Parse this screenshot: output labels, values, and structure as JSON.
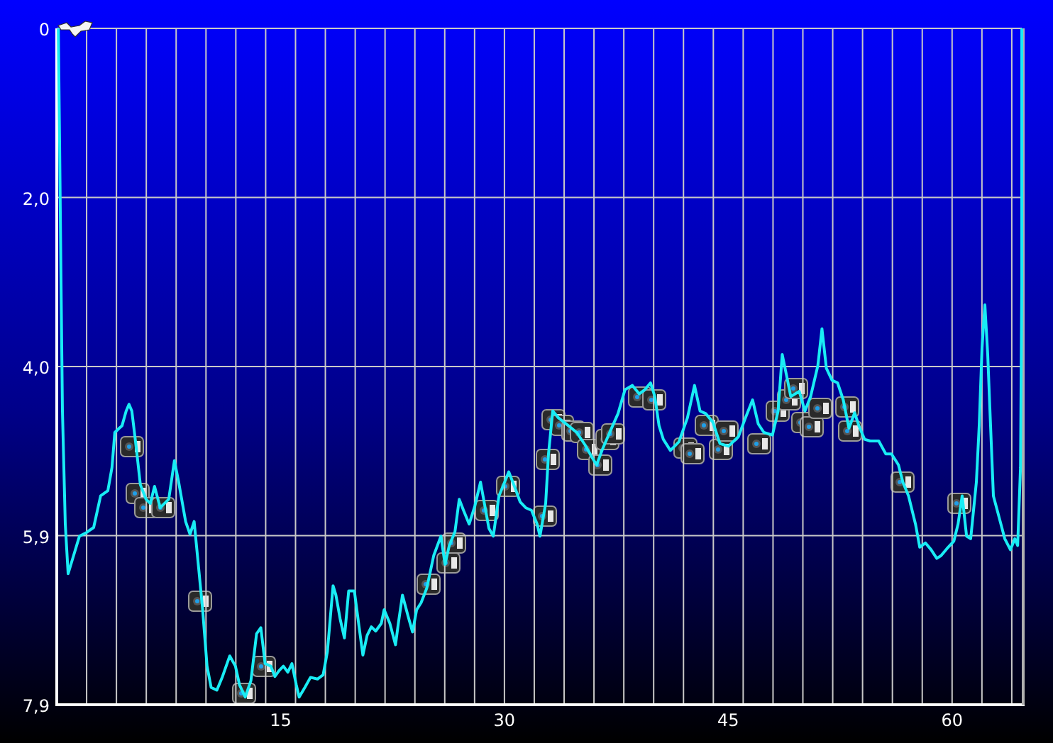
{
  "chart_data": {
    "type": "line",
    "grid": true,
    "xlim": [
      0,
      64.67
    ],
    "ylim": [
      7.9,
      0
    ],
    "xticks": [
      15,
      30,
      45,
      60
    ],
    "yticks": [
      {
        "value": 0,
        "label": "0"
      },
      {
        "value": 1.975,
        "label": "2,0"
      },
      {
        "value": 3.95,
        "label": "4,0"
      },
      {
        "value": 5.925,
        "label": "5,9"
      },
      {
        "value": 7.9,
        "label": "7,9"
      }
    ],
    "x": [
      0.1,
      0.19,
      0.28,
      0.38,
      0.57,
      0.76,
      1.04,
      1.52,
      1.99,
      2.47,
      2.94,
      3.42,
      3.7,
      3.89,
      4.18,
      4.37,
      4.65,
      4.84,
      5.03,
      5.32,
      5.6,
      5.98,
      6.27,
      6.55,
      6.93,
      7.5,
      7.88,
      8.17,
      8.64,
      8.93,
      9.21,
      9.5,
      9.78,
      10.07,
      10.35,
      10.73,
      11.11,
      11.59,
      11.97,
      12.25,
      12.63,
      13.01,
      13.39,
      13.68,
      13.96,
      14.34,
      14.62,
      14.91,
      15.19,
      15.48,
      15.76,
      16.05,
      16.24,
      16.62,
      17.0,
      17.47,
      17.85,
      18.14,
      18.52,
      18.71,
      18.99,
      19.28,
      19.56,
      19.94,
      20.23,
      20.51,
      20.8,
      21.08,
      21.37,
      21.75,
      21.94,
      22.32,
      22.7,
      22.89,
      23.17,
      23.55,
      23.84,
      24.12,
      24.41,
      24.79,
      25.26,
      25.74,
      26.02,
      26.31,
      26.69,
      26.97,
      27.26,
      27.64,
      28.02,
      28.4,
      28.96,
      29.25,
      29.63,
      30.01,
      30.29,
      30.67,
      31.05,
      31.43,
      31.81,
      32.19,
      32.38,
      32.76,
      32.95,
      33.24,
      33.62,
      34.28,
      34.85,
      35.42,
      35.9,
      36.18,
      36.56,
      37.13,
      37.61,
      38.08,
      38.56,
      39.03,
      39.41,
      39.79,
      40.08,
      40.36,
      40.65,
      41.12,
      41.69,
      42.26,
      42.74,
      43.11,
      43.49,
      43.97,
      44.44,
      45.01,
      45.68,
      46.15,
      46.63,
      47.01,
      47.39,
      47.96,
      48.34,
      48.62,
      48.91,
      49.19,
      49.76,
      50.14,
      50.52,
      51.0,
      51.28,
      51.57,
      51.95,
      52.33,
      52.71,
      53.09,
      53.47,
      53.75,
      54.13,
      54.51,
      55.08,
      55.56,
      55.94,
      56.41,
      56.7,
      57.08,
      57.55,
      57.83,
      58.21,
      58.59,
      58.97,
      59.26,
      59.64,
      60.11,
      60.4,
      60.68,
      60.97,
      61.25,
      61.63,
      61.82,
      62.01,
      62.2,
      62.39,
      62.58,
      62.77,
      63.15,
      63.53,
      63.91,
      64.2,
      64.39,
      64.58,
      64.67,
      64.67
    ],
    "series": [
      {
        "color": "#19ecf5",
        "values": [
          0,
          1.32,
          2.81,
          4.47,
          5.79,
          6.37,
          6.21,
          5.93,
          5.89,
          5.83,
          5.46,
          5.4,
          5.13,
          4.72,
          4.67,
          4.64,
          4.47,
          4.39,
          4.47,
          4.88,
          5.33,
          5.5,
          5.55,
          5.35,
          5.6,
          5.5,
          5.05,
          5.3,
          5.76,
          5.91,
          5.76,
          6.29,
          6.79,
          7.45,
          7.7,
          7.73,
          7.57,
          7.33,
          7.45,
          7.67,
          7.81,
          7.62,
          7.07,
          7.0,
          7.42,
          7.45,
          7.57,
          7.5,
          7.45,
          7.52,
          7.42,
          7.67,
          7.81,
          7.7,
          7.58,
          7.6,
          7.55,
          7.28,
          6.51,
          6.62,
          6.9,
          7.12,
          6.57,
          6.57,
          6.95,
          7.32,
          7.09,
          6.99,
          7.04,
          6.95,
          6.79,
          6.95,
          7.2,
          6.95,
          6.62,
          6.87,
          7.05,
          6.79,
          6.71,
          6.54,
          6.16,
          5.93,
          6.26,
          6.04,
          5.88,
          5.5,
          5.63,
          5.79,
          5.58,
          5.3,
          5.84,
          5.93,
          5.46,
          5.3,
          5.18,
          5.35,
          5.53,
          5.6,
          5.63,
          5.79,
          5.93,
          5.55,
          4.97,
          4.47,
          4.55,
          4.64,
          4.72,
          4.87,
          5.02,
          5.1,
          4.92,
          4.69,
          4.5,
          4.22,
          4.17,
          4.27,
          4.22,
          4.14,
          4.3,
          4.64,
          4.8,
          4.93,
          4.83,
          4.55,
          4.17,
          4.47,
          4.5,
          4.6,
          4.85,
          4.88,
          4.77,
          4.55,
          4.34,
          4.62,
          4.72,
          4.75,
          4.47,
          3.81,
          4.06,
          4.3,
          4.24,
          4.47,
          4.3,
          3.94,
          3.51,
          3.97,
          4.11,
          4.14,
          4.34,
          4.67,
          4.49,
          4.64,
          4.8,
          4.82,
          4.82,
          4.97,
          4.97,
          5.1,
          5.3,
          5.46,
          5.79,
          6.06,
          6.01,
          6.09,
          6.19,
          6.16,
          6.08,
          5.99,
          5.79,
          5.46,
          5.93,
          5.96,
          5.3,
          4.64,
          3.73,
          3.23,
          3.81,
          4.64,
          5.46,
          5.71,
          5.96,
          6.09,
          5.96,
          6.04,
          5.13,
          2.98,
          0
        ]
      }
    ]
  }
}
